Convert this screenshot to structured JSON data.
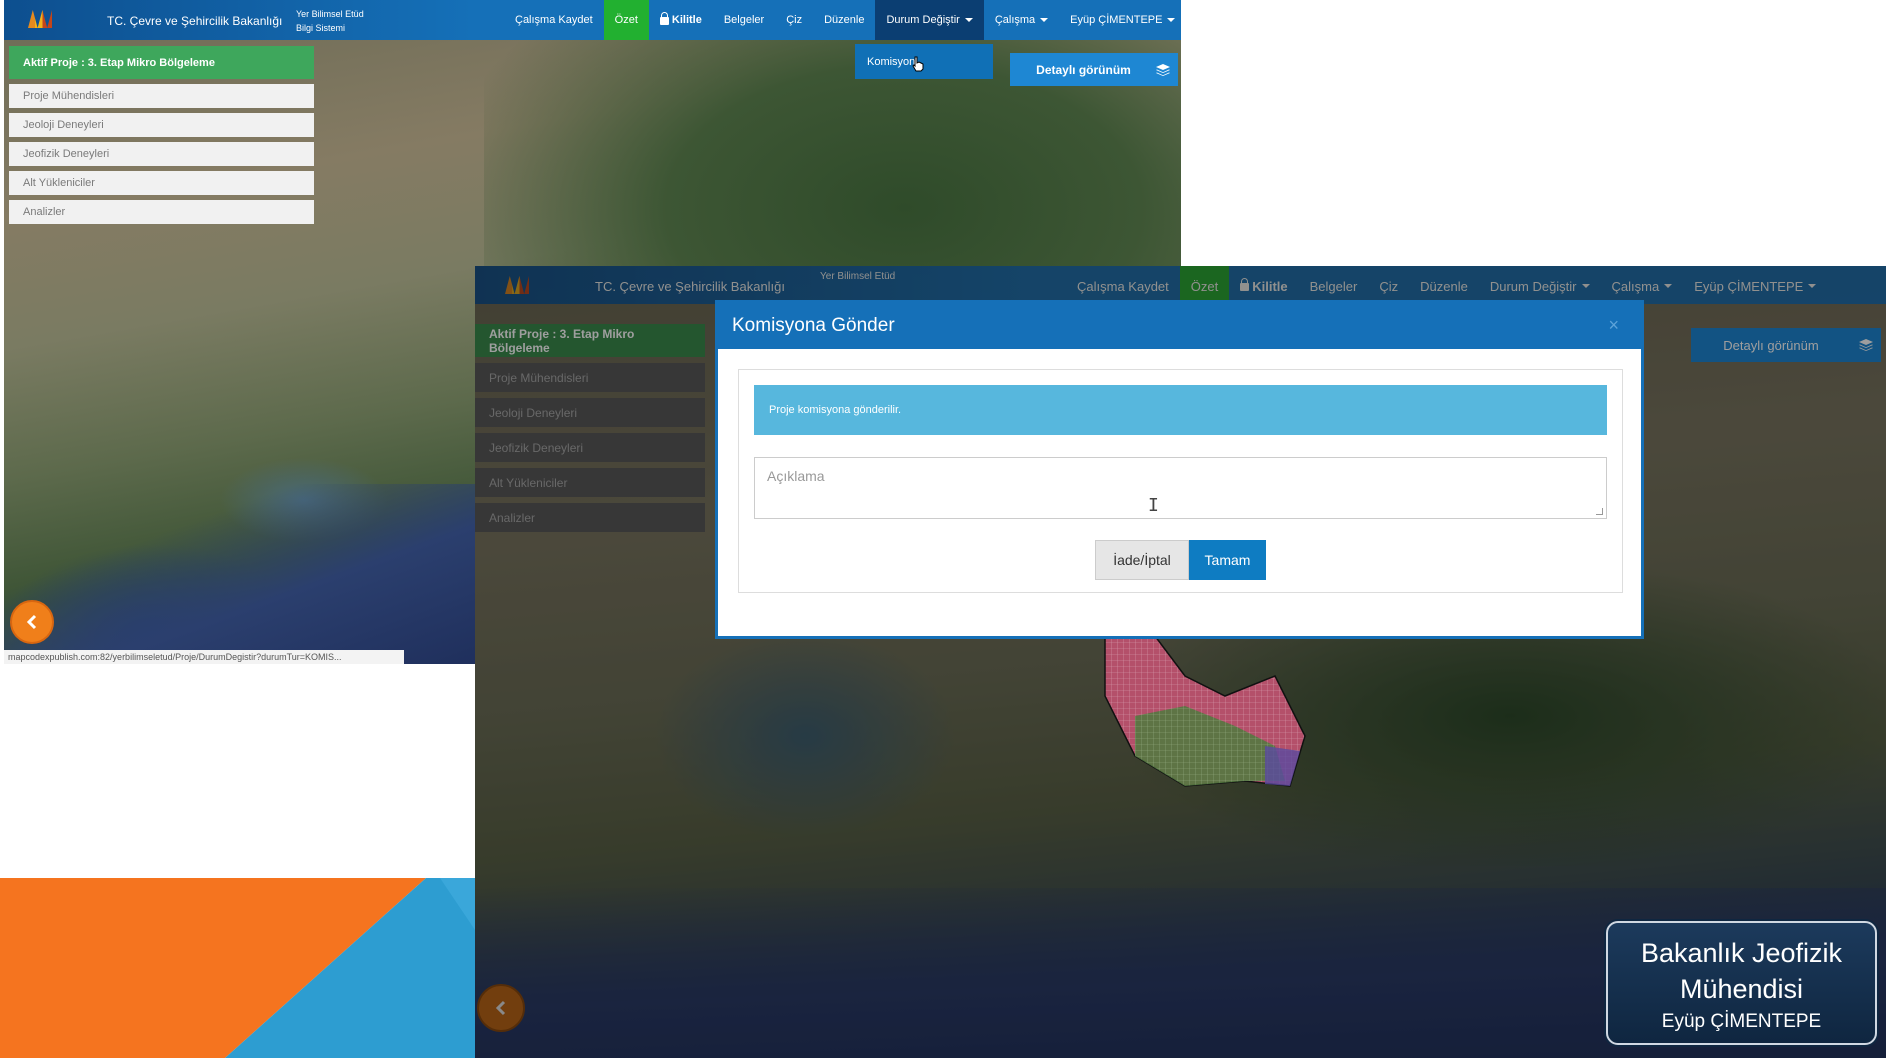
{
  "app": {
    "brand": "TC. Çevre ve Şehircilik Bakanlığı",
    "subbrand_line1": "Yer Bilimsel Etüd",
    "subbrand_line2": "Bilgi Sistemi"
  },
  "nav": {
    "items": [
      {
        "label": "Çalışma Kaydet"
      },
      {
        "label": "Özet"
      },
      {
        "label": "Kilitle"
      },
      {
        "label": "Belgeler"
      },
      {
        "label": "Çiz"
      },
      {
        "label": "Düzenle"
      },
      {
        "label": "Durum Değiştir"
      },
      {
        "label": "Çalışma"
      },
      {
        "label": "Eyüp ÇİMENTEPE"
      }
    ],
    "dropdown_item": "Komisyon"
  },
  "sidebar": {
    "active_project": "Aktif Proje : 3. Etap Mikro Bölgeleme",
    "items": [
      {
        "label": "Proje Mühendisleri"
      },
      {
        "label": "Jeoloji Deneyleri"
      },
      {
        "label": "Jeofizik Deneyleri"
      },
      {
        "label": "Alt Yükleniciler"
      },
      {
        "label": "Analizler"
      }
    ]
  },
  "map_controls": {
    "detail_view": "Detaylı görünüm"
  },
  "statusbar": {
    "url": "mapcodexpublish.com:82/yerbilimseletud/Proje/DurumDegistir?durumTur=KOMIS..."
  },
  "modal": {
    "title": "Komisyona Gönder",
    "close": "×",
    "alert": "Proje komisyona gönderilir.",
    "textarea_placeholder": "Açıklama",
    "cancel": "İade/İptal",
    "ok": "Tamam"
  },
  "caption": {
    "line1": "Bakanlık Jeofizik",
    "line2": "Mühendisi",
    "line3": "Eyüp ÇİMENTEPE"
  },
  "colors": {
    "nav_blue": "#1570b8",
    "green_active": "#3ea75c",
    "ozet_green": "#22b030",
    "back_button_orange": "#f07f1a",
    "alert_blue": "#57b7dd",
    "slide_orange": "#f5741f",
    "slide_blue": "#2d9dd1"
  },
  "icons": {
    "logo": "ministry-logo",
    "lock": "lock-icon",
    "layers": "layers-icon",
    "back": "chevron-left-icon",
    "cursor": "hand-cursor-icon"
  }
}
